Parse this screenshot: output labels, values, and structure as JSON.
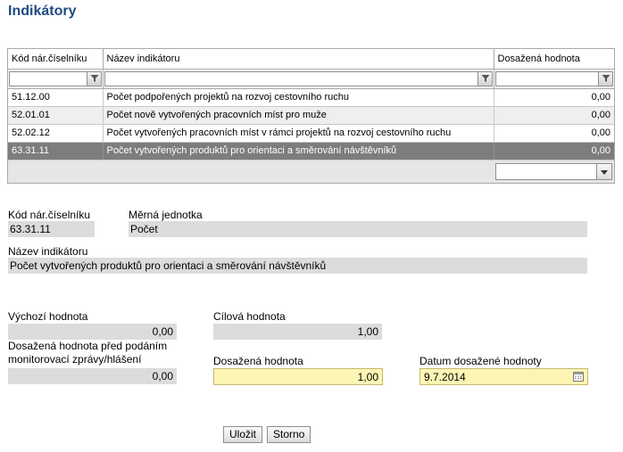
{
  "page": {
    "title": "Indikátory"
  },
  "grid": {
    "columns": [
      "Kód nár.číselníku",
      "Název indikátoru",
      "Dosažená hodnota"
    ],
    "filters": [
      "",
      "",
      ""
    ],
    "rows": [
      {
        "code": "51.12.00",
        "name": "Počet podpořených projektů na rozvoj cestovního ruchu",
        "value": "0,00"
      },
      {
        "code": "52.01.01",
        "name": "Počet nově vytvořených pracovních míst pro muže",
        "value": "0,00"
      },
      {
        "code": "52.02.12",
        "name": "Počet vytvořených pracovních míst v rámci projektů na rozvoj cestovního ruchu",
        "value": "0,00"
      },
      {
        "code": "63.31.11",
        "name": "Počet vytvořených produktů pro orientaci a směrování návštěvníků",
        "value": "0,00"
      }
    ],
    "selected_row": 3,
    "pager_value": ""
  },
  "detail": {
    "code_label": "Kód nár.číselníku",
    "code_value": "63.31.11",
    "unit_label": "Měrná jednotka",
    "unit_value": "Počet",
    "name_label": "Název indikátoru",
    "name_value": "Počet vytvořených produktů pro orientaci a směrování návštěvníků",
    "initial_label": "Výchozí hodnota",
    "initial_value": "0,00",
    "target_label": "Cílová hodnota",
    "target_value": "1,00",
    "before_label_line1": "Dosažená hodnota před podáním",
    "before_label_line2": "monitorovací zprávy/hlášení",
    "before_value": "0,00",
    "achieved_label": "Dosažená hodnota",
    "achieved_value": "1,00",
    "date_label": "Datum dosažené hodnoty",
    "date_value": "9.7.2014"
  },
  "buttons": {
    "save": "Uložit",
    "cancel": "Storno"
  },
  "colors": {
    "title": "#1f4b82",
    "selected_row": "#7d7d7d",
    "editable_field": "#fdf5b4",
    "readonly_field": "#dcdcdc"
  },
  "icons": {
    "filter": "filter-icon",
    "dropdown": "chevron-down-icon",
    "calendar": "calendar-icon"
  }
}
